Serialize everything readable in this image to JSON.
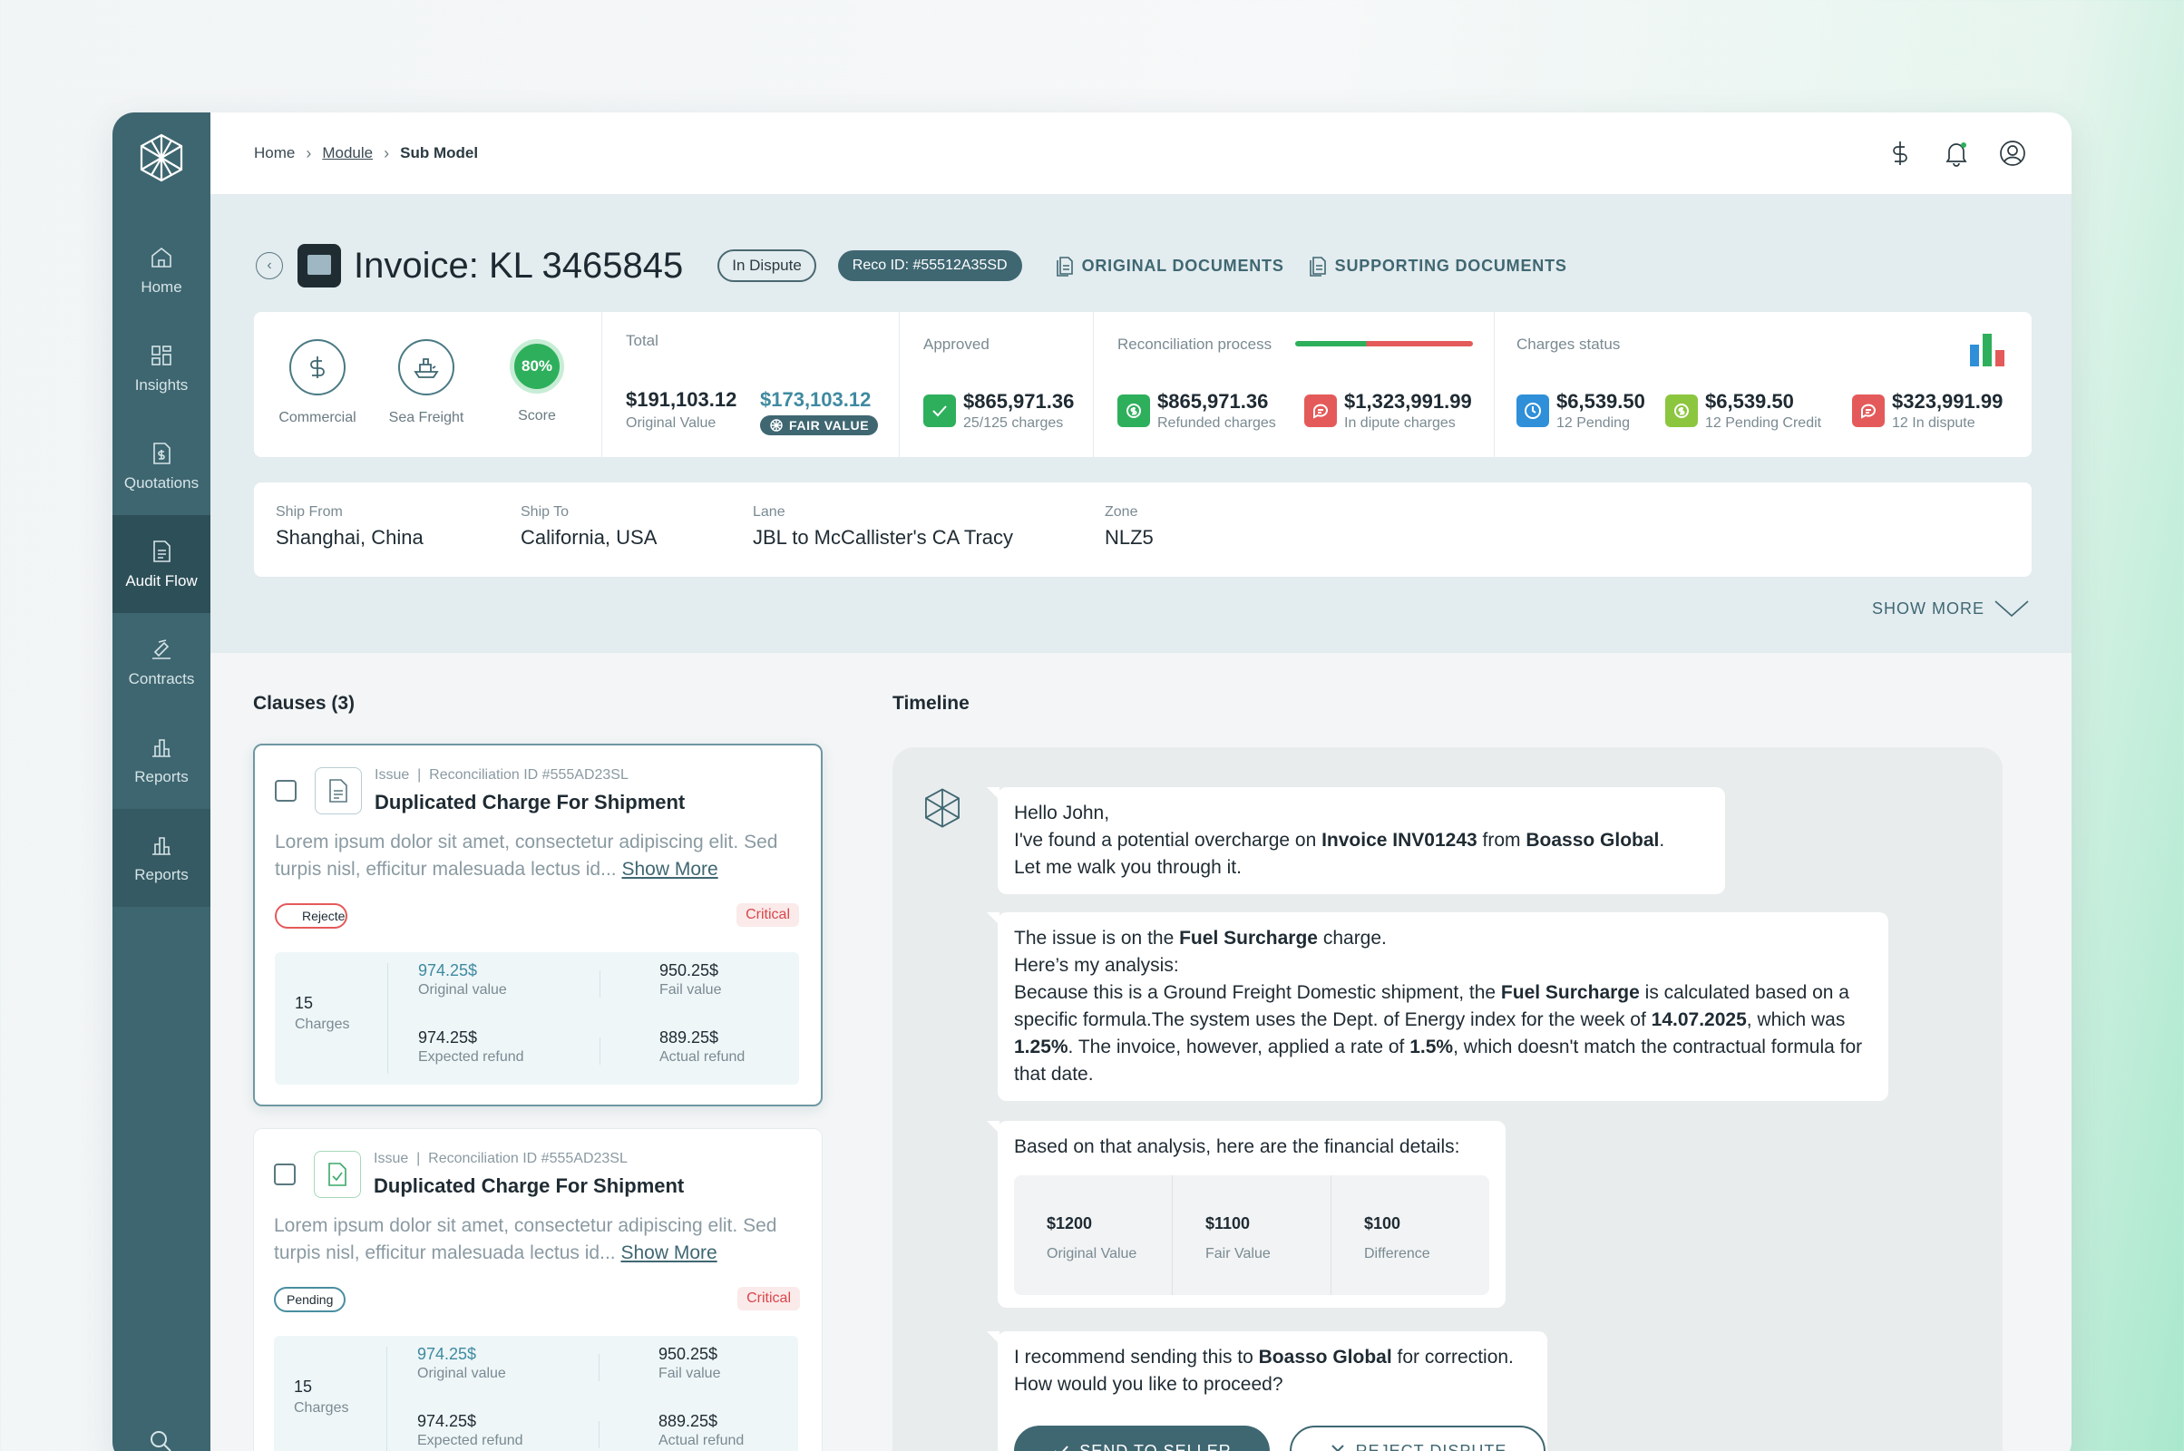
{
  "nav": {
    "items": [
      {
        "label": "Home",
        "icon": "home-icon"
      },
      {
        "label": "Insights",
        "icon": "grid-icon"
      },
      {
        "label": "Quotations",
        "icon": "quote-doc-icon"
      },
      {
        "label": "Audit Flow",
        "icon": "audit-doc-icon",
        "active": true
      },
      {
        "label": "Contracts",
        "icon": "signature-icon"
      },
      {
        "label": "Reports",
        "icon": "bar-chart-icon"
      },
      {
        "label": "Reports",
        "icon": "bar-chart-icon"
      }
    ]
  },
  "breadcrumb": {
    "home": "Home",
    "module": "Module",
    "current": "Sub Model"
  },
  "topbar": {
    "icons": [
      "dollar-icon",
      "bell-icon",
      "user-icon"
    ]
  },
  "invoice": {
    "title": "Invoice: KL 3465845",
    "status": "In Dispute",
    "reco": "Reco ID: #55512A35SD",
    "original_docs": "ORIGINAL DOCUMENTS",
    "supporting_docs": "SUPPORTING DOCUMENTS"
  },
  "stats": {
    "commercial": "Commercial",
    "sea_freight": "Sea Freight",
    "score": "80%",
    "score_label": "Score",
    "total_label": "Total",
    "original_value": "$191,103.12",
    "original_value_label": "Original Value",
    "fair_value": "$173,103.12",
    "fair_value_chip": "FAIR VALUE",
    "approved_label": "Approved",
    "approved_value": "$865,971.36",
    "approved_sub": "25/125 charges",
    "recon_label": "Reconciliation process",
    "refunded_value": "$865,971.36",
    "refunded_sub": "Refunded charges",
    "dispute_value": "$1,323,991.99",
    "dispute_sub": "In dipute charges",
    "charges_label": "Charges status",
    "pending_value": "$6,539.50",
    "pending_sub": "12 Pending",
    "credit_value": "$6,539.50",
    "credit_sub": "12 Pending Credit",
    "indispute_value": "$323,991.99",
    "indispute_sub": "12 In dispute",
    "colors": {
      "green": "#2eaf5c",
      "red": "#e45a5a",
      "blue": "#2f8fd8",
      "lime": "#8cc63f"
    }
  },
  "shipment": {
    "from_label": "Ship From",
    "from": "Shanghai, China",
    "to_label": "Ship To",
    "to": "California, USA",
    "lane_label": "Lane",
    "lane": "JBL to McCallister's CA Tracy",
    "zone_label": "Zone",
    "zone": "NLZ5"
  },
  "show_more": "SHOW MORE",
  "clauses": {
    "heading": "Clauses (3)",
    "items": [
      {
        "meta": "Issue  |  Reconciliation ID #555AD23SL",
        "title": "Duplicated Charge For Shipment",
        "body": "Lorem ipsum dolor sit amet, consectetur adipiscing elit. Sed turpis nisl, efficitur malesuada lectus id...",
        "more": "Show More",
        "status": "Rejected",
        "severity": "Critical",
        "count": "15",
        "count_label": "Charges",
        "original": "974.25$",
        "original_label": "Original value",
        "fail": "950.25$",
        "fail_label": "Fail value",
        "expected": "974.25$",
        "expected_label": "Expected refund",
        "actual": "889.25$",
        "actual_label": "Actual refund"
      },
      {
        "meta": "Issue  |  Reconciliation ID #555AD23SL",
        "title": "Duplicated Charge For Shipment",
        "body": "Lorem ipsum dolor sit amet, consectetur adipiscing elit. Sed turpis nisl, efficitur malesuada lectus id...",
        "more": "Show More",
        "status": "Pending",
        "severity": "Critical",
        "count": "15",
        "count_label": "Charges",
        "original": "974.25$",
        "original_label": "Original value",
        "fail": "950.25$",
        "fail_label": "Fail value",
        "expected": "974.25$",
        "expected_label": "Expected refund",
        "actual": "889.25$",
        "actual_label": "Actual refund"
      }
    ]
  },
  "timeline": {
    "heading": "Timeline",
    "msg1_l1": "Hello John,",
    "msg1_l2a": "I've found a potential overcharge on ",
    "msg1_l2b": "Invoice INV01243",
    "msg1_l2c": " from ",
    "msg1_l2d": "Boasso Global",
    "msg1_l2e": ".",
    "msg1_l3": "Let me walk you through it.",
    "msg2_a": "The issue is on the ",
    "msg2_b": "Fuel Surcharge",
    "msg2_c": " charge.",
    "msg2_d": "Here’s my analysis:",
    "msg2_e": "Because this is a Ground Freight Domestic shipment, the ",
    "msg2_f": "Fuel Surcharge",
    "msg2_g": " is calculated based on a specific formula.The system uses the Dept. of Energy index for the week of ",
    "msg2_h": "14.07.2025",
    "msg2_i": ", which was ",
    "msg2_j": "1.25%",
    "msg2_k": ". The invoice, however, applied a rate of ",
    "msg2_l": "1.5%",
    "msg2_m": ", which doesn't match the contractual formula for that date.",
    "msg3": "Based on that analysis, here are the financial details:",
    "fin": [
      {
        "value": "$1200",
        "label": "Original Value"
      },
      {
        "value": "$1100",
        "label": "Fair Value"
      },
      {
        "value": "$100",
        "label": "Difference"
      }
    ],
    "msg4_a": "I recommend sending this to ",
    "msg4_b": "Boasso Global",
    "msg4_c": " for correction.",
    "msg4_d": "How would you like to proceed?",
    "send": "SEND TO SELLER",
    "reject": "REJECT DISPUTE"
  }
}
